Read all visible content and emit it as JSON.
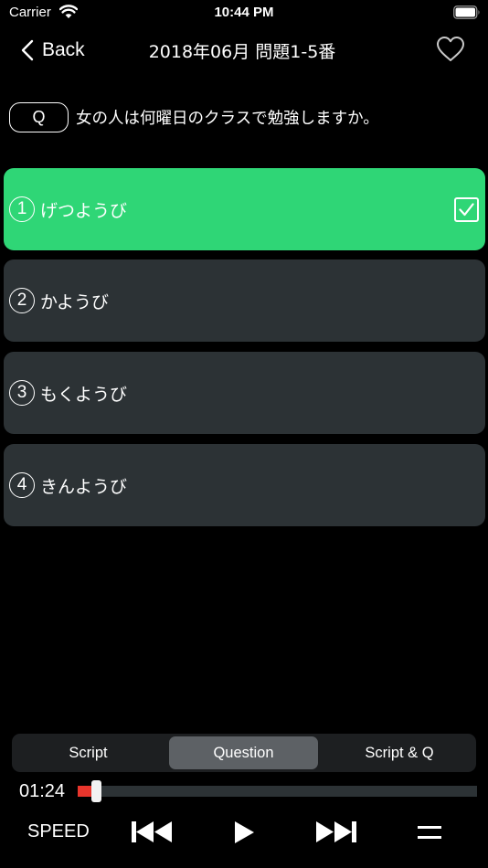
{
  "status_bar": {
    "carrier": "Carrier",
    "time": "10:44 PM"
  },
  "nav": {
    "back_label": "Back",
    "title": "2018年06月 問題1-5番"
  },
  "question": {
    "badge": "Q",
    "text": "女の人は何曜日のクラスで勉強しますか。"
  },
  "choices": [
    {
      "number": "1",
      "text": "げつようび",
      "selected": true
    },
    {
      "number": "2",
      "text": "かようび",
      "selected": false
    },
    {
      "number": "3",
      "text": "もくようび",
      "selected": false
    },
    {
      "number": "4",
      "text": "きんようび",
      "selected": false
    }
  ],
  "segments": {
    "items": [
      "Script",
      "Question",
      "Script & Q"
    ],
    "active": "Question"
  },
  "player": {
    "elapsed": "01:24",
    "progress": 0.045,
    "speed_label": "SPEED"
  },
  "colors": {
    "selected_choice": "#2fd676",
    "choice_bg": "#2c3235",
    "progress_fill": "#e8352c"
  },
  "icons": [
    "wifi-icon",
    "battery-icon",
    "chevron-left-icon",
    "heart-icon",
    "check-icon",
    "skip-back-icon",
    "play-icon",
    "skip-forward-icon",
    "menu-icon"
  ]
}
